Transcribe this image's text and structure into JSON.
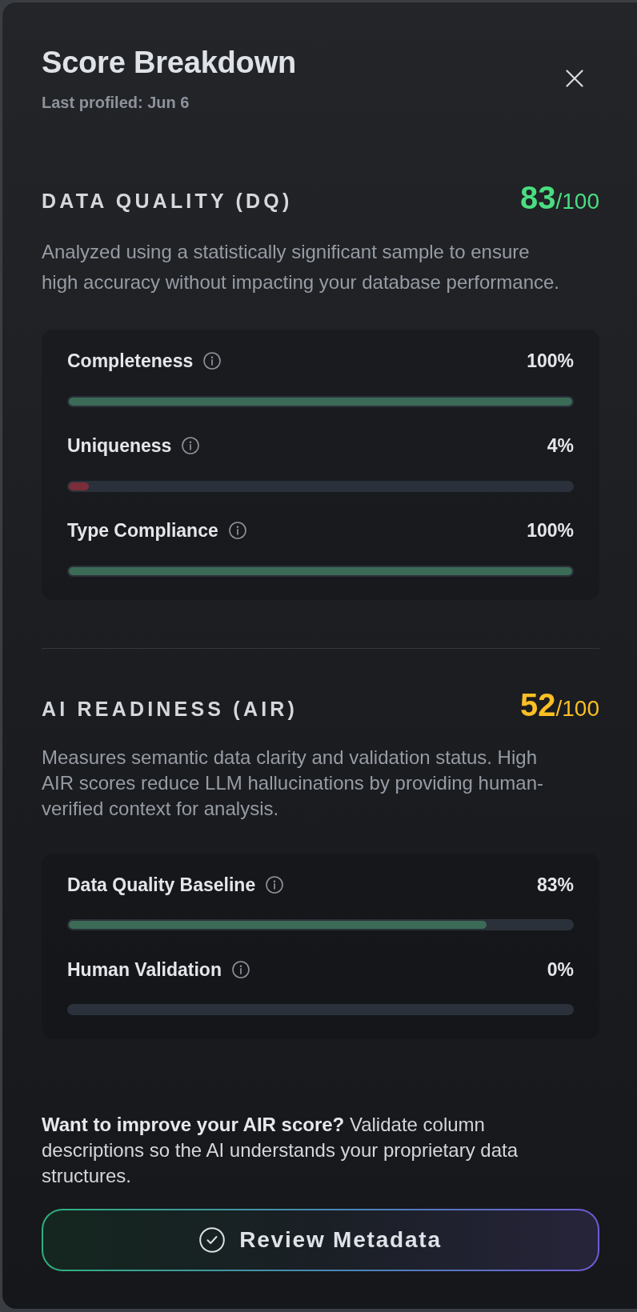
{
  "panel": {
    "title": "Score Breakdown",
    "subtitle": "Last profiled: Jun 6"
  },
  "sections": [
    {
      "heading": "DATA QUALITY (DQ)",
      "score": "83",
      "score_max": "/100",
      "color": "#4ade80",
      "description": "Analyzed using a statistically significant sample to ensure high accuracy without impacting your database performance.",
      "metrics": [
        {
          "label": "Completeness",
          "value": "100%",
          "level": 1
        },
        {
          "label": "Uniqueness",
          "value": "4%",
          "level": 0.04
        },
        {
          "label": "Type Compliance",
          "value": "100%",
          "level": 1
        }
      ]
    },
    {
      "heading": "AI READINESS (AIR)",
      "score": "52",
      "score_max": "/100",
      "color": "#fbbf24",
      "description": "Measures semantic data clarity and validation status. High AIR scores reduce LLM hallucinations by providing human-verified context for analysis.",
      "metrics": [
        {
          "label": "Data Quality Baseline",
          "value": "83%",
          "level": 0.83
        },
        {
          "label": "Human Validation",
          "value": "0%"
        }
      ]
    }
  ],
  "tip": "**Want to improve your AIR score?** Validate column descriptions so the AI understands your proprietary data structures.",
  "button": {
    "label": "Review Metadata"
  }
}
